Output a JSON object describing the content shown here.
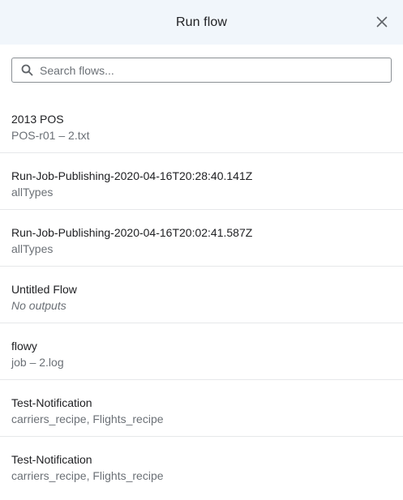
{
  "dialog": {
    "title": "Run flow",
    "close_icon": "close-icon"
  },
  "search": {
    "placeholder": "Search flows...",
    "value": "",
    "icon": "search-icon"
  },
  "flows": [
    {
      "name": "2013 POS",
      "outputs": "POS-r01 – 2.txt"
    },
    {
      "name": "Run-Job-Publishing-2020-04-16T20:28:40.141Z",
      "outputs": "allTypes"
    },
    {
      "name": "Run-Job-Publishing-2020-04-16T20:02:41.587Z",
      "outputs": "allTypes"
    },
    {
      "name": "Untitled Flow",
      "outputs": "No outputs"
    },
    {
      "name": "flowy",
      "outputs": "job – 2.log"
    },
    {
      "name": "Test-Notification",
      "outputs": "carriers_recipe, Flights_recipe"
    },
    {
      "name": "Test-Notification",
      "outputs": "carriers_recipe, Flights_recipe"
    }
  ]
}
